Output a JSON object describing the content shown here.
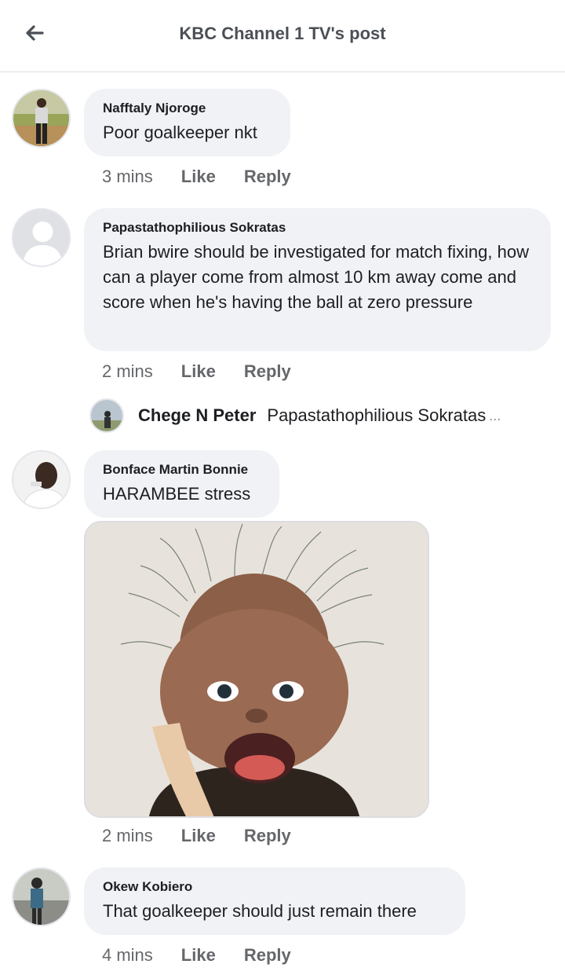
{
  "header": {
    "title": "KBC Channel 1 TV's post",
    "back_icon": "arrow-left-icon"
  },
  "comments": [
    {
      "author": "Nafftaly Njoroge",
      "text": "Poor goalkeeper nkt",
      "time": "3 mins",
      "like": "Like",
      "reply": "Reply"
    },
    {
      "author": "Papastathophilious Sokratas",
      "text": "Brian bwire should be investigated for match fixing, how can a player come from almost 10 km away come and score when he's having the ball at zero pressure",
      "time": "2 mins",
      "like": "Like",
      "reply": "Reply"
    },
    {
      "author": "Bonface Martin Bonnie",
      "text": "HARAMBEE stress",
      "time": "2 mins",
      "like": "Like",
      "reply": "Reply"
    },
    {
      "author": "Okew Kobiero",
      "text": "That goalkeeper should just remain there",
      "time": "4 mins",
      "like": "Like",
      "reply": "Reply"
    }
  ],
  "reply_preview": {
    "author": "Chege N Peter",
    "text": "Papastathophilious Sokratas",
    "ellipsis": "..."
  },
  "colors": {
    "bubble": "#f0f2f5",
    "meta": "#65676b",
    "header_text": "#4b4f56"
  }
}
